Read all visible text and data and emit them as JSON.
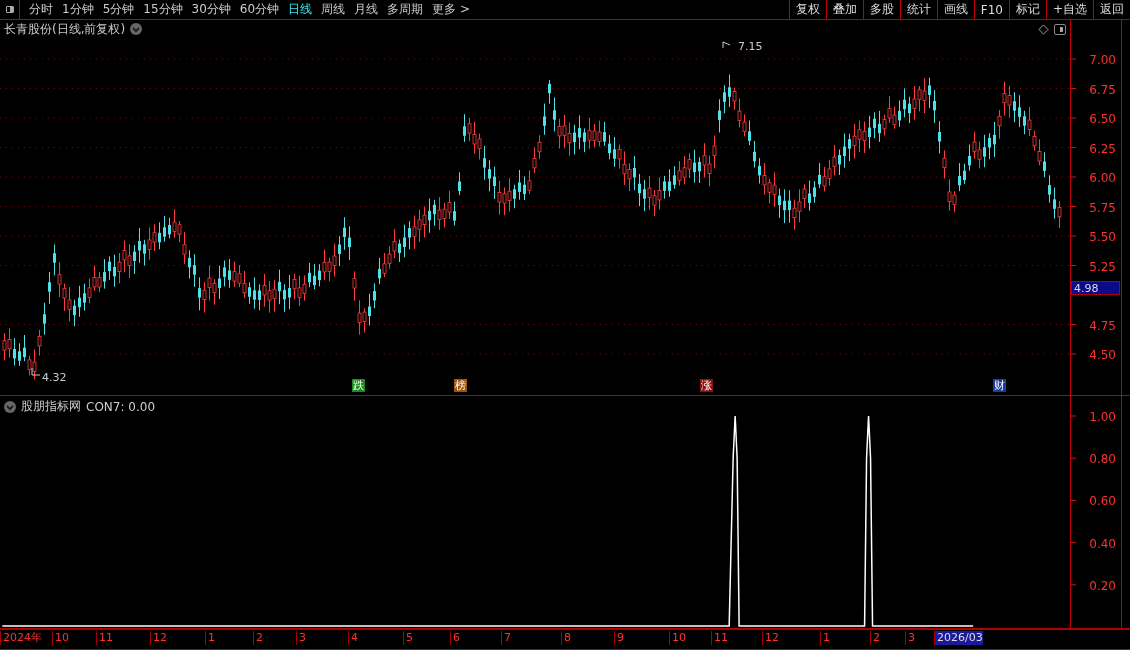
{
  "toolbar": {
    "tabs": [
      {
        "label": "分时",
        "selected": false
      },
      {
        "label": "1分钟",
        "selected": false
      },
      {
        "label": "5分钟",
        "selected": false
      },
      {
        "label": "15分钟",
        "selected": false
      },
      {
        "label": "30分钟",
        "selected": false
      },
      {
        "label": "60分钟",
        "selected": false
      },
      {
        "label": "日线",
        "selected": true
      },
      {
        "label": "周线",
        "selected": false
      },
      {
        "label": "月线",
        "selected": false
      },
      {
        "label": "多周期",
        "selected": false
      },
      {
        "label": "更多 >",
        "selected": false
      }
    ],
    "buttons": [
      "复权",
      "叠加",
      "多股",
      "统计",
      "画线",
      "F10",
      "标记",
      "+自选",
      "返回"
    ]
  },
  "price_chart": {
    "title": "长青股份(日线,前复权)",
    "high_label": "7.15",
    "low_label": "4.32",
    "current_price": "4.98",
    "y_labels": [
      "7.00",
      "6.75",
      "6.50",
      "6.25",
      "6.00",
      "5.75",
      "5.50",
      "5.25",
      "4.75",
      "4.50"
    ],
    "markers": [
      {
        "label": "跌",
        "color": "#1a8a1a"
      },
      {
        "label": "榜",
        "color": "#a0520a"
      },
      {
        "label": "涨",
        "color": "#8a1010"
      },
      {
        "label": "财",
        "color": "#1a3ca0"
      }
    ]
  },
  "indicator": {
    "title": "股朋指标网",
    "reading": "CON7: 0.00",
    "y_labels": [
      "1.00",
      "0.80",
      "0.60",
      "0.40",
      "0.20"
    ]
  },
  "date_axis": [
    {
      "label": "2024年",
      "selected": false
    },
    {
      "label": "10",
      "selected": false
    },
    {
      "label": "11",
      "selected": false
    },
    {
      "label": "12",
      "selected": false
    },
    {
      "label": "1",
      "selected": false
    },
    {
      "label": "2",
      "selected": false
    },
    {
      "label": "3",
      "selected": false
    },
    {
      "label": "4",
      "selected": false
    },
    {
      "label": "5",
      "selected": false
    },
    {
      "label": "6",
      "selected": false
    },
    {
      "label": "7",
      "selected": false
    },
    {
      "label": "8",
      "selected": false
    },
    {
      "label": "9",
      "selected": false
    },
    {
      "label": "10",
      "selected": false
    },
    {
      "label": "11",
      "selected": false
    },
    {
      "label": "12",
      "selected": false
    },
    {
      "label": "1",
      "selected": false
    },
    {
      "label": "2",
      "selected": false
    },
    {
      "label": "3",
      "selected": false
    },
    {
      "label": "2026/03",
      "selected": true
    }
  ]
}
